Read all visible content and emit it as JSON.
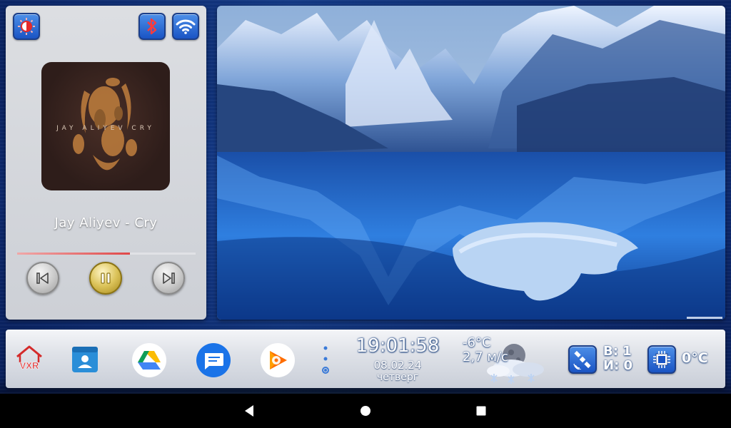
{
  "media": {
    "song_title": "Jay Aliyev - Cry",
    "album_text": "JAY ALIYEV  CRY",
    "progress": 0.63
  },
  "dock": {
    "launcher_label": "VXR",
    "clock": {
      "time": "19:01:58",
      "date": "08.02.24",
      "day": "четверг"
    },
    "weather": {
      "temperature": "-6°C",
      "wind": "2,7 м/с"
    },
    "gps": {
      "line1": "B: 1",
      "line2": "И: 0"
    },
    "cpu_temp": "0°C"
  },
  "colors": {
    "accent_blue": "#1a54c4",
    "progress_red": "#e04848",
    "pause_gold": "#dcc45b"
  },
  "icons": {
    "brightness": "brightness-icon",
    "bluetooth": "bluetooth-icon",
    "wifi": "wifi-icon",
    "prev": "skip-previous-icon",
    "pause": "pause-icon",
    "next": "skip-next-icon",
    "home": "home-icon",
    "contacts": "contacts-icon",
    "drive": "google-drive-icon",
    "messages": "messages-icon",
    "play_music": "play-music-icon",
    "page_dots": "page-indicator-icon",
    "weather": "weather-snow-moon-icon",
    "satellite": "satellite-icon",
    "chip": "cpu-chip-icon",
    "back": "back-icon",
    "home_nav": "home-nav-icon",
    "recents": "recents-icon"
  }
}
